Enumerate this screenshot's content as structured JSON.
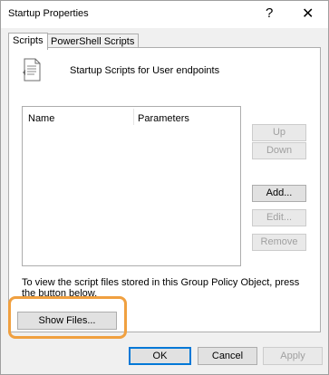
{
  "window": {
    "title": "Startup Properties",
    "help_glyph": "?",
    "close_glyph": "✕"
  },
  "tabs": [
    {
      "label": "Scripts",
      "active": true
    },
    {
      "label": "PowerShell Scripts",
      "active": false
    }
  ],
  "scripts_panel": {
    "header_icon": "script-document-icon",
    "header_text": "Startup Scripts for User endpoints",
    "list": {
      "columns": [
        "Name",
        "Parameters"
      ],
      "rows": []
    },
    "side_buttons": {
      "up": "Up",
      "down": "Down",
      "add": "Add...",
      "edit": "Edit...",
      "remove": "Remove"
    },
    "info_text": "To view the script files stored in this Group Policy Object, press the button below.",
    "show_files": "Show Files..."
  },
  "footer": {
    "ok": "OK",
    "cancel": "Cancel",
    "apply": "Apply"
  },
  "colors": {
    "highlight": "#f0a040",
    "default_button_border": "#0078d7",
    "disabled_text": "#a0a0a0"
  }
}
